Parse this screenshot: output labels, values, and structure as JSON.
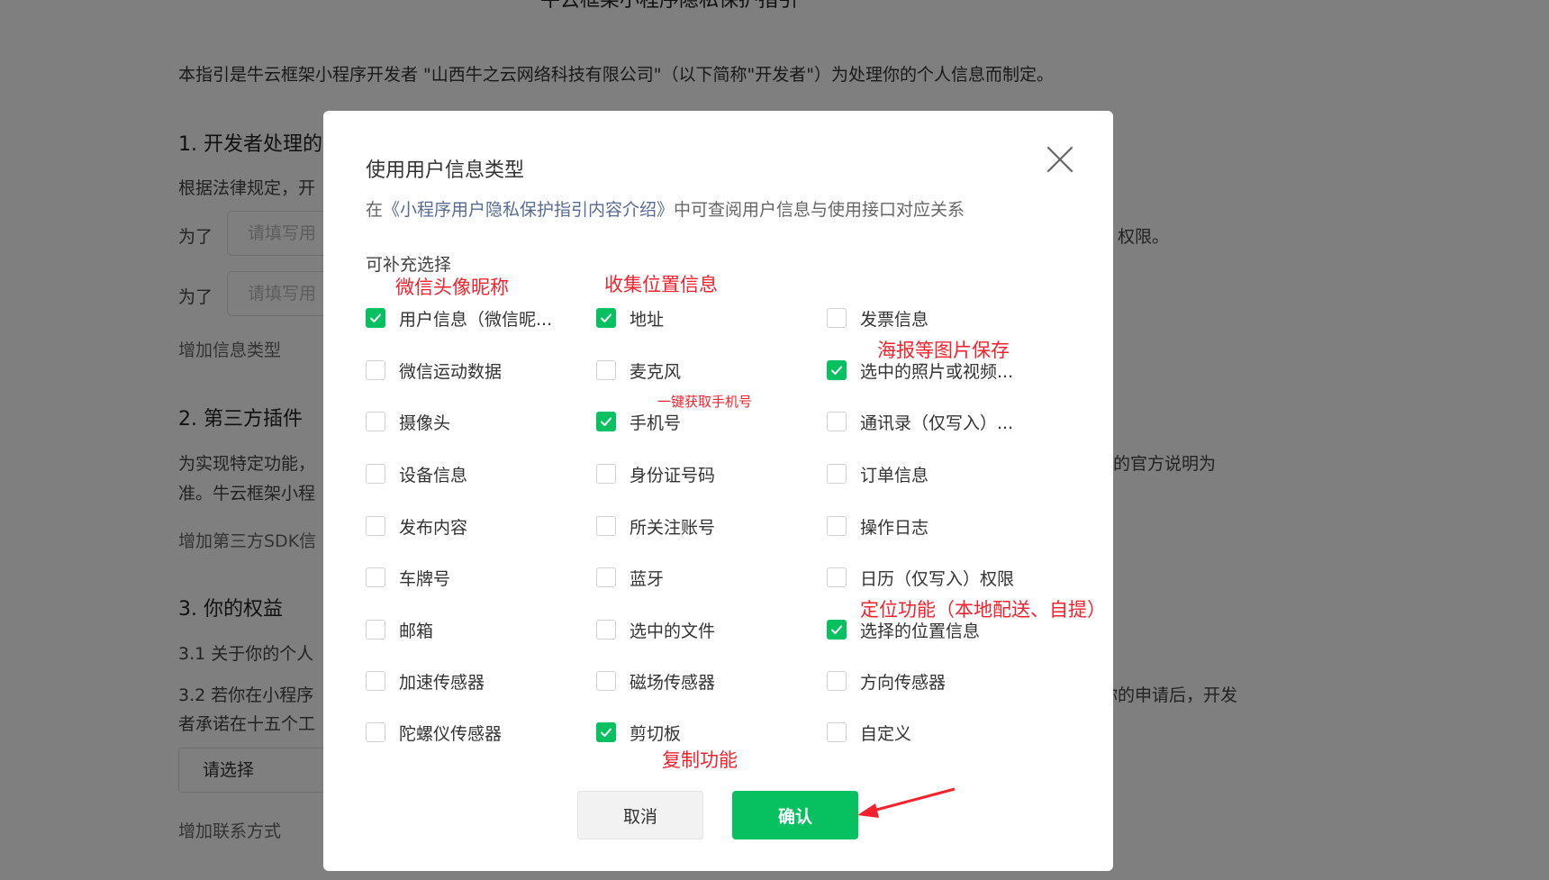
{
  "background": {
    "title": "牛云框架小程序隐私保护指引",
    "intro": "本指引是牛云框架小程序开发者 \"山西牛之云网络科技有限公司\"（以下简称\"开发者\"）为处理你的个人信息而制定。",
    "section1_heading": "1. 开发者处理的",
    "section1_text": "根据法律规定，开",
    "for_label_1": "为了",
    "for_label_2": "为了",
    "input_placeholder_1": "请填写用",
    "input_placeholder_2": "请填写用",
    "permission_suffix": "）权限。",
    "add_info_type": "增加信息类型",
    "section2_heading": "2. 第三方插件",
    "section2_text_1": "为实现特定功能，",
    "section2_text_1_right": "的官方说明为",
    "section2_text_2": "准。牛云框架小程",
    "add_sdk": "增加第三方SDK信",
    "section3_heading": "3. 你的权益",
    "section3_1": "3.1  关于你的个人",
    "section3_2": "3.2  若你在小程序",
    "section3_2_right": "你的申请后，开发",
    "section3_2_line2": "者承诺在十五个工",
    "select_value": "请选择",
    "add_contact": "增加联系方式"
  },
  "dialog": {
    "title": "使用用户信息类型",
    "desc_prefix": "在",
    "desc_link": "《小程序用户隐私保护指引内容介绍》",
    "desc_suffix": "中可查阅用户信息与使用接口对应关系",
    "section_label": "可补充选择",
    "options": [
      {
        "label": "用户信息（微信昵...",
        "checked": true
      },
      {
        "label": "地址",
        "checked": true
      },
      {
        "label": "发票信息",
        "checked": false
      },
      {
        "label": "微信运动数据",
        "checked": false
      },
      {
        "label": "麦克风",
        "checked": false
      },
      {
        "label": "选中的照片或视频...",
        "checked": true
      },
      {
        "label": "摄像头",
        "checked": false
      },
      {
        "label": "手机号",
        "checked": true
      },
      {
        "label": "通讯录（仅写入）...",
        "checked": false
      },
      {
        "label": "设备信息",
        "checked": false
      },
      {
        "label": "身份证号码",
        "checked": false
      },
      {
        "label": "订单信息",
        "checked": false
      },
      {
        "label": "发布内容",
        "checked": false
      },
      {
        "label": "所关注账号",
        "checked": false
      },
      {
        "label": "操作日志",
        "checked": false
      },
      {
        "label": "车牌号",
        "checked": false
      },
      {
        "label": "蓝牙",
        "checked": false
      },
      {
        "label": "日历（仅写入）权限",
        "checked": false
      },
      {
        "label": "邮箱",
        "checked": false
      },
      {
        "label": "选中的文件",
        "checked": false
      },
      {
        "label": "选择的位置信息",
        "checked": true
      },
      {
        "label": "加速传感器",
        "checked": false
      },
      {
        "label": "磁场传感器",
        "checked": false
      },
      {
        "label": "方向传感器",
        "checked": false
      },
      {
        "label": "陀螺仪传感器",
        "checked": false
      },
      {
        "label": "剪切板",
        "checked": true
      },
      {
        "label": "自定义",
        "checked": false
      }
    ],
    "cancel_label": "取消",
    "confirm_label": "确认"
  },
  "annotations": {
    "wechat_avatar": "微信头像昵称",
    "collect_location": "收集位置信息",
    "poster_save": "海报等图片保存",
    "one_click_phone": "一键获取手机号",
    "location_feature": "定位功能（本地配送、自提）",
    "copy_feature": "复制功能"
  },
  "colors": {
    "accent": "#07c160",
    "link": "#576b95",
    "annotation": "#f5222d"
  }
}
